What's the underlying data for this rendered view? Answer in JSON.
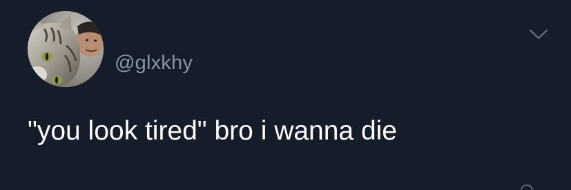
{
  "tweet": {
    "handle": "@glxkhy",
    "text": "\"you look tired\" bro i wanna die",
    "avatar_icon": "cat-and-person-avatar",
    "menu_icon": "chevron-down-icon"
  },
  "colors": {
    "background": "#161d2a",
    "handle": "#8a96a3",
    "text": "#ffffff",
    "icon": "#5b6673"
  }
}
